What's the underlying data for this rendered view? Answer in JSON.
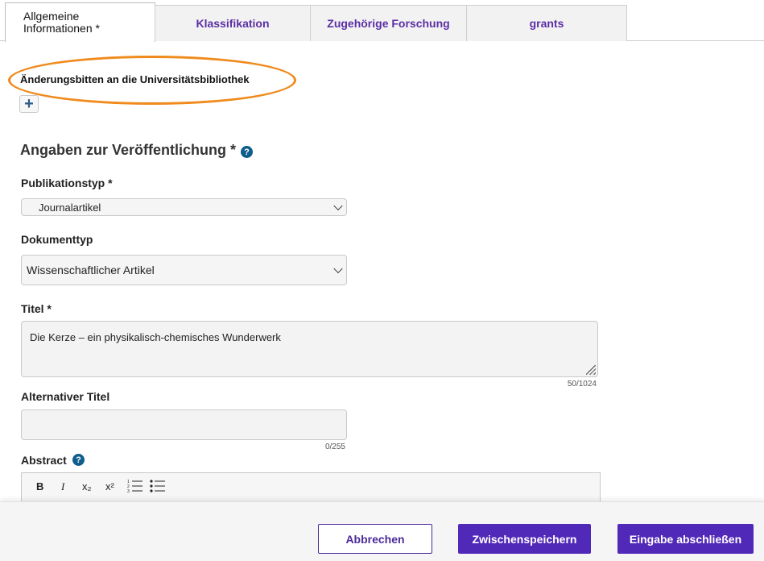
{
  "tabs": [
    {
      "line1": "Allgemeine",
      "line2": "Informationen *"
    },
    {
      "label": "Klassifikation"
    },
    {
      "label": "Zugehörige Forschung"
    },
    {
      "label": "grants"
    }
  ],
  "change_request": {
    "title": "Änderungsbitten an die Universitätsbibliothek",
    "add_icon": "+"
  },
  "section": {
    "title": "Angaben zur Veröffentlichung *",
    "help_icon": "?"
  },
  "fields": {
    "pubtype": {
      "label": "Publikationstyp *",
      "value": "Journalartikel"
    },
    "doctype": {
      "label": "Dokumenttyp",
      "value": "Wissenschaftlicher Artikel"
    },
    "title": {
      "label": "Titel *",
      "value": "Die Kerze – ein physikalisch-chemisches Wunderwerk",
      "counter": "50/1024"
    },
    "alt_title": {
      "label": "Alternativer Titel",
      "value": "",
      "counter": "0/255"
    },
    "abstract": {
      "label": "Abstract",
      "help_icon": "?"
    }
  },
  "editor_toolbar": {
    "bold": "B",
    "italic": "I",
    "subscript": "x₂",
    "superscript": "x²"
  },
  "footer": {
    "cancel": "Abbrechen",
    "save": "Zwischenspeichern",
    "finish": "Eingabe abschließen"
  },
  "colors": {
    "accent": "#5129b8",
    "highlight_oval": "#f08a1c",
    "help": "#0f5d8c"
  }
}
